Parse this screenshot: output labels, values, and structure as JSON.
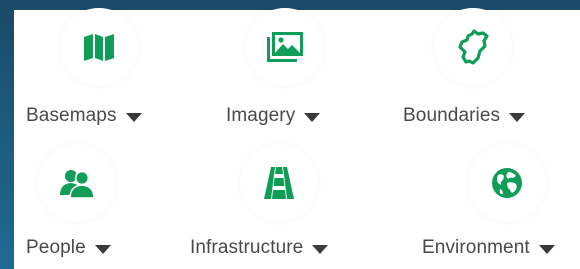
{
  "categories": [
    {
      "id": "basemaps",
      "label": "Basemaps",
      "icon": "map-icon"
    },
    {
      "id": "imagery",
      "label": "Imagery",
      "icon": "image-icon"
    },
    {
      "id": "boundaries",
      "label": "Boundaries",
      "icon": "boundary-icon"
    },
    {
      "id": "people",
      "label": "People",
      "icon": "people-icon"
    },
    {
      "id": "infrastructure",
      "label": "Infrastructure",
      "icon": "road-icon"
    },
    {
      "id": "environment",
      "label": "Environment",
      "icon": "globe-icon"
    }
  ],
  "colors": {
    "icon_green": "#0f9d58",
    "label_text": "#4a4a4a",
    "caret": "#3a3a3a",
    "background": "#1d5d80"
  }
}
